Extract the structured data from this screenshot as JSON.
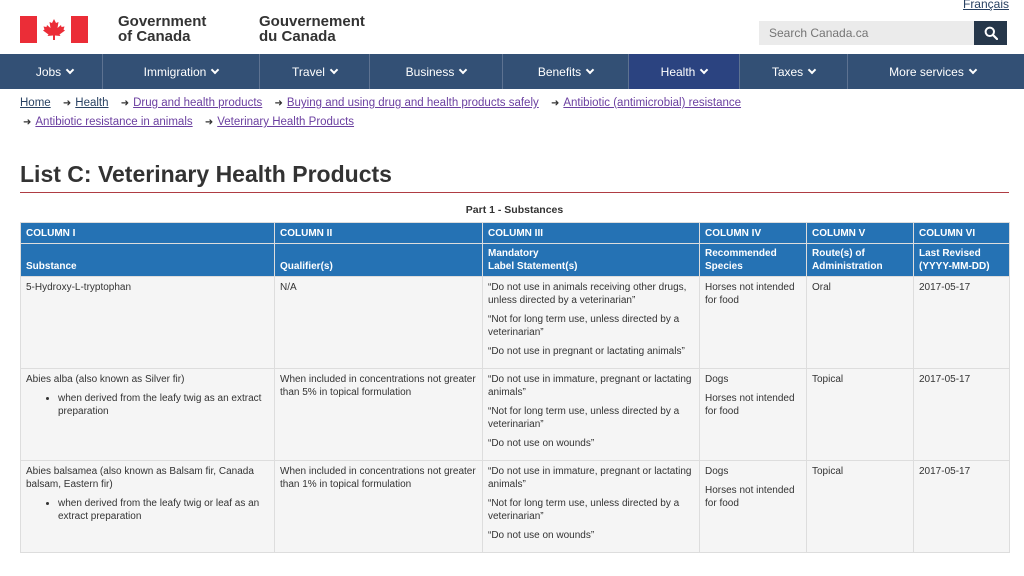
{
  "header": {
    "lang_link": "Français",
    "gov_en_line1": "Government",
    "gov_en_line2": "of Canada",
    "gov_fr_line1": "Gouvernement",
    "gov_fr_line2": "du Canada",
    "search_placeholder": "Search Canada.ca",
    "flag_color": "#eb2d37"
  },
  "nav": {
    "items": [
      {
        "label": "Jobs"
      },
      {
        "label": "Immigration"
      },
      {
        "label": "Travel"
      },
      {
        "label": "Business"
      },
      {
        "label": "Benefits"
      },
      {
        "label": "Health"
      },
      {
        "label": "Taxes"
      },
      {
        "label": "More services"
      }
    ]
  },
  "breadcrumb": {
    "items": [
      "Home",
      "Health",
      "Drug and health products",
      "Buying and using drug and health products safely",
      "Antibiotic (antimicrobial) resistance",
      "Antibiotic resistance in animals",
      "Veterinary Health Products"
    ]
  },
  "page": {
    "title": "List C: Veterinary Health Products",
    "caption": "Part 1 - Substances"
  },
  "table": {
    "columns": [
      {
        "col": "COLUMN I",
        "label": "Substance"
      },
      {
        "col": "COLUMN II",
        "label": "Qualifier(s)"
      },
      {
        "col": "COLUMN III",
        "label1": "Mandatory",
        "label2": "Label Statement(s)"
      },
      {
        "col": "COLUMN IV",
        "label1": "Recommended",
        "label2": "Species"
      },
      {
        "col": "COLUMN V",
        "label1": "Route(s) of",
        "label2": "Administration"
      },
      {
        "col": "COLUMN VI",
        "label1": "Last Revised",
        "label2": "(YYYY-MM-DD)"
      }
    ],
    "rows": [
      {
        "substance": "5-Hydroxy-L-tryptophan",
        "bullet": "",
        "qualifier": "N/A",
        "statements": [
          "“Do not use in animals receiving other drugs, unless directed by a veterinarian”",
          "“Not for long term use, unless directed by a veterinarian”",
          "“Do not use in pregnant or lactating animals”"
        ],
        "species": [
          "Horses not intended for food"
        ],
        "route": "Oral",
        "revised": "2017-05-17"
      },
      {
        "substance": "Abies alba (also known as Silver fir)",
        "bullet": "when derived from the leafy twig as an extract preparation",
        "qualifier": "When included in concentrations not greater than 5% in topical formulation",
        "statements": [
          "“Do not use in immature, pregnant or lactating animals”",
          "“Not for long term use, unless directed by a veterinarian”",
          "“Do not use on wounds”"
        ],
        "species": [
          "Dogs",
          "Horses not intended for food"
        ],
        "route": "Topical",
        "revised": "2017-05-17"
      },
      {
        "substance": "Abies balsamea (also known as Balsam fir, Canada balsam, Eastern fir)",
        "bullet": "when derived from the leafy twig or leaf as an extract preparation",
        "qualifier": "When included in concentrations not greater than 1% in topical formulation",
        "statements": [
          "“Do not use in immature, pregnant or lactating animals”",
          "“Not for long term use, unless directed by a veterinarian”",
          "“Do not use on wounds”"
        ],
        "species": [
          "Dogs",
          "Horses not intended for food"
        ],
        "route": "Topical",
        "revised": "2017-05-17"
      }
    ]
  }
}
